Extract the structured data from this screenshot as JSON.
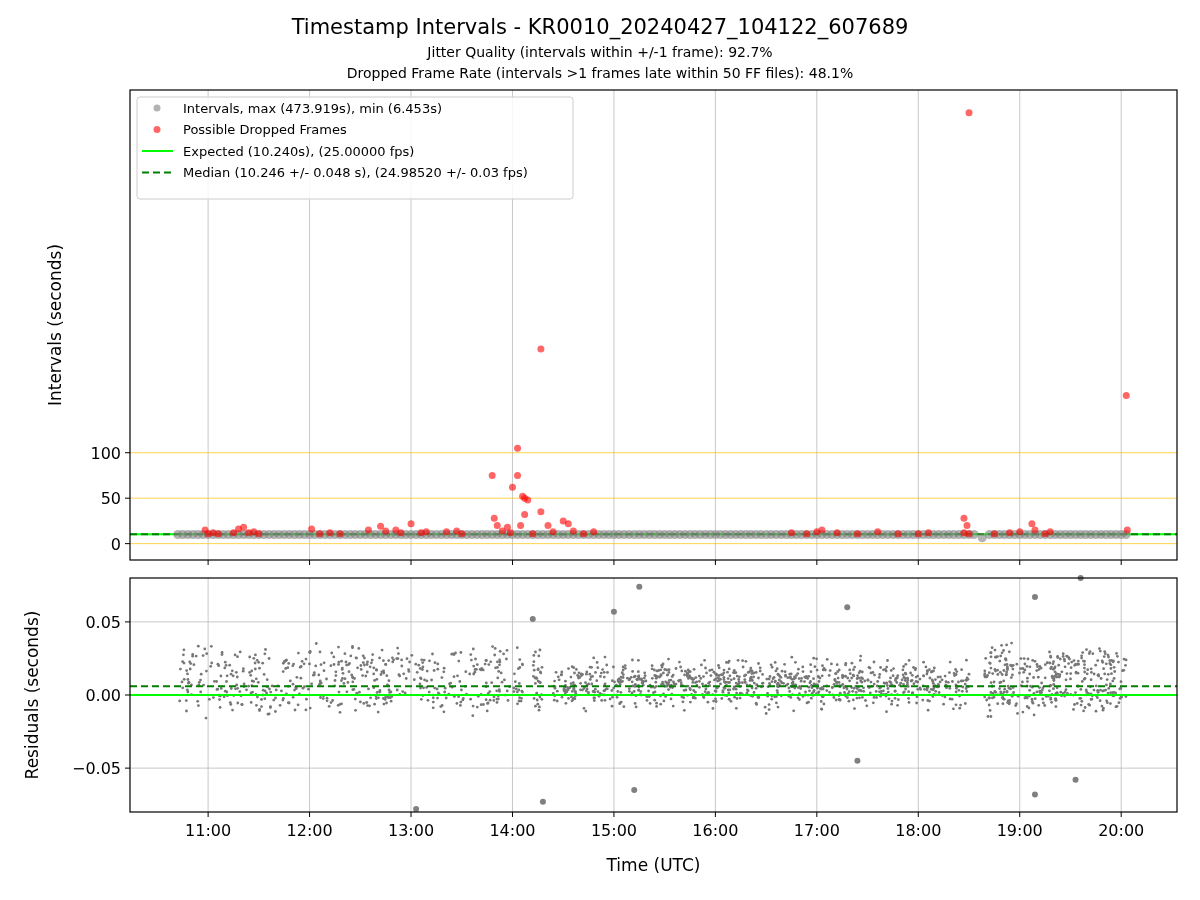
{
  "figure": {
    "title": "Timestamp Intervals - KR0010_20240427_104122_607689",
    "subtitles": [
      "Jitter Quality (intervals within +/-1 frame): 92.7%",
      "Dropped Frame Rate (intervals >1 frames late within 50 FF files): 48.1%"
    ]
  },
  "charts": [
    {
      "chart_data": {
        "type": "scatter",
        "ylabel": "Intervals (seconds)",
        "xlim": [
          10.23,
          20.55
        ],
        "ylim": [
          -18,
          499
        ],
        "grid": true,
        "yticks": [
          {
            "value": 0,
            "label": "0"
          },
          {
            "value": 50,
            "label": "50"
          },
          {
            "value": 100,
            "label": "100"
          }
        ],
        "series": [
          {
            "name": "Intervals, max (473.919s), min (6.453s)",
            "color": "#808080",
            "x": [
              10.7,
              10.75,
              10.8,
              10.85,
              10.9,
              10.95,
              11.0,
              11.05,
              11.1,
              11.15,
              11.2,
              11.25,
              11.3,
              11.35,
              11.4,
              11.45,
              11.5,
              11.55,
              11.6,
              11.65,
              11.7,
              11.75,
              11.8,
              11.85,
              11.9,
              11.95,
              12.0,
              12.05,
              12.1,
              12.15,
              12.2,
              12.25,
              12.3,
              12.35,
              12.4,
              12.45,
              12.5,
              12.55,
              12.6,
              12.65,
              12.7,
              12.75,
              12.8,
              12.85,
              12.9,
              12.95,
              13.0,
              13.05,
              13.1,
              13.15,
              13.2,
              13.25,
              13.3,
              13.35,
              13.4,
              13.45,
              13.5,
              13.55,
              13.6,
              13.65,
              13.7,
              13.75,
              13.8,
              13.85,
              13.9,
              13.95,
              14.0,
              14.05,
              14.1,
              14.15,
              14.2,
              14.25,
              14.3,
              14.35,
              14.4,
              14.45,
              14.5,
              14.55,
              14.6,
              14.65,
              14.7,
              14.75,
              14.8,
              14.85,
              14.9,
              14.95,
              15.0,
              15.05,
              15.1,
              15.15,
              15.2,
              15.25,
              15.3,
              15.35,
              15.4,
              15.45,
              15.5,
              15.55,
              15.6,
              15.65,
              15.7,
              15.75,
              15.8,
              15.85,
              15.9,
              15.95,
              16.0,
              16.05,
              16.1,
              16.15,
              16.2,
              16.25,
              16.3,
              16.35,
              16.4,
              16.45,
              16.5,
              16.55,
              16.6,
              16.65,
              16.7,
              16.75,
              16.8,
              16.85,
              16.9,
              16.95,
              17.0,
              17.05,
              17.1,
              17.15,
              17.2,
              17.25,
              17.3,
              17.35,
              17.4,
              17.45,
              17.5,
              17.55,
              17.6,
              17.65,
              17.7,
              17.75,
              17.8,
              17.85,
              17.9,
              17.95,
              18.0,
              18.05,
              18.1,
              18.15,
              18.2,
              18.25,
              18.3,
              18.35,
              18.4,
              18.45,
              18.5,
              18.55,
              18.63,
              18.7,
              18.75,
              18.8,
              18.85,
              18.9,
              18.95,
              19.0,
              19.05,
              19.1,
              19.15,
              19.2,
              19.25,
              19.3,
              19.35,
              19.4,
              19.45,
              19.5,
              19.55,
              19.6,
              19.65,
              19.7,
              19.75,
              19.8,
              19.85,
              19.9,
              19.95,
              20.0,
              20.05
            ],
            "values": [
              10,
              10,
              10,
              10,
              10,
              10,
              10,
              10,
              10,
              10,
              10,
              10,
              10,
              10,
              10,
              10,
              10,
              10,
              10,
              10,
              10,
              10,
              10,
              10,
              10,
              10,
              10,
              10,
              10,
              10,
              10,
              10,
              10,
              10,
              10,
              10,
              10,
              10,
              10,
              10,
              10,
              10,
              10,
              10,
              10,
              10,
              10,
              10,
              10,
              10,
              10,
              10,
              10,
              10,
              10,
              10,
              10,
              10,
              10,
              10,
              10,
              10,
              10,
              10,
              10,
              10,
              10,
              10,
              10,
              10,
              10,
              10,
              10,
              10,
              10,
              10,
              10,
              10,
              10,
              10,
              10,
              10,
              10,
              10,
              10,
              10,
              10,
              10,
              10,
              10,
              10,
              10,
              10,
              10,
              10,
              10,
              10,
              10,
              10,
              10,
              10,
              10,
              10,
              10,
              10,
              10,
              10,
              10,
              10,
              10,
              10,
              10,
              10,
              10,
              10,
              10,
              10,
              10,
              10,
              10,
              10,
              10,
              10,
              10,
              10,
              10,
              10,
              10,
              10,
              10,
              10,
              10,
              10,
              10,
              10,
              10,
              10,
              10,
              10,
              10,
              10,
              10,
              10,
              10,
              10,
              10,
              10,
              10,
              10,
              10,
              10,
              10,
              10,
              10,
              10,
              10,
              10,
              10,
              6.5,
              10,
              10,
              10,
              10,
              10,
              10,
              10,
              10,
              10,
              10,
              10,
              10,
              10,
              10,
              10,
              10,
              10,
              10,
              10,
              10,
              10,
              10,
              10,
              10,
              10,
              10,
              10,
              10
            ]
          },
          {
            "name": "Possible Dropped Frames",
            "color": "#ff0000",
            "x": [
              10.97,
              11.0,
              11.05,
              11.1,
              11.25,
              11.3,
              11.35,
              11.4,
              11.45,
              11.5,
              12.02,
              12.1,
              12.2,
              12.3,
              12.58,
              12.7,
              12.75,
              12.85,
              12.9,
              13.0,
              13.1,
              13.15,
              13.35,
              13.45,
              13.5,
              13.8,
              13.82,
              13.85,
              13.9,
              13.95,
              14.0,
              14.05,
              14.05,
              14.08,
              14.1,
              14.12,
              14.15,
              14.12,
              13.98,
              14.2,
              14.28,
              14.28,
              14.35,
              14.4,
              14.5,
              14.55,
              14.6,
              14.7,
              14.8,
              16.75,
              16.9,
              17.0,
              17.05,
              17.2,
              17.4,
              17.6,
              17.8,
              18.0,
              18.1,
              18.45,
              18.48,
              18.5,
              18.45,
              18.5,
              18.75,
              18.9,
              19.0,
              19.12,
              19.15,
              19.25,
              19.3,
              20.05,
              20.06
            ],
            "values": [
              15,
              11,
              12,
              11,
              12,
              16,
              18,
              12,
              13,
              11,
              16,
              11,
              12,
              11,
              15,
              19,
              14,
              15,
              12,
              22,
              12,
              13,
              13,
              14,
              11,
              75,
              28,
              20,
              14,
              18,
              62,
              105,
              75,
              20,
              52,
              50,
              48,
              32,
              12,
              11,
              35,
              214,
              20,
              13,
              25,
              22,
              14,
              11,
              13,
              12,
              11,
              13,
              15,
              12,
              11,
              13,
              11,
              11,
              12,
              28,
              20,
              474,
              12,
              11,
              11,
              12,
              13,
              22,
              15,
              11,
              13,
              163,
              15
            ]
          }
        ],
        "ref_lines": [
          {
            "axis": "y",
            "value": 10.24,
            "label": "Expected (10.240s), (25.00000 fps)",
            "color": "#00ff00"
          },
          {
            "axis": "y",
            "value": 10.246,
            "label": "Median (10.246 +/- 0.048 s), (24.98520 +/- 0.03 fps)",
            "color": "#008000"
          }
        ],
        "legend": "upper left"
      }
    },
    {
      "chart_data": {
        "type": "scatter",
        "xlabel": "Time (UTC)",
        "ylabel": "Residuals (seconds)",
        "xlim": [
          10.23,
          20.55
        ],
        "ylim": [
          -0.08,
          0.08
        ],
        "grid": true,
        "xticks": [
          {
            "value": 11,
            "label": "11:00"
          },
          {
            "value": 12,
            "label": "12:00"
          },
          {
            "value": 13,
            "label": "13:00"
          },
          {
            "value": 14,
            "label": "14:00"
          },
          {
            "value": 15,
            "label": "15:00"
          },
          {
            "value": 16,
            "label": "16:00"
          },
          {
            "value": 17,
            "label": "17:00"
          },
          {
            "value": 18,
            "label": "18:00"
          },
          {
            "value": 19,
            "label": "19:00"
          },
          {
            "value": 20,
            "label": "20:00"
          }
        ],
        "yticks": [
          {
            "value": 0.05,
            "label": "0.05"
          },
          {
            "value": 0,
            "label": "0.00"
          },
          {
            "value": -0.05,
            "label": "−0.05"
          }
        ],
        "series": [
          {
            "color": "#808080",
            "x": [
              13.05,
              14.3,
              15.2,
              15.25,
              17.4,
              19.15,
              19.55,
              19.15,
              19.6,
              14.2,
              15.0,
              17.3
            ],
            "values": [
              -0.078,
              -0.073,
              -0.065,
              0.074,
              -0.045,
              -0.068,
              -0.058,
              0.067,
              0.08,
              0.052,
              0.057,
              0.06
            ]
          }
        ],
        "ref_lines": [
          {
            "axis": "y",
            "value": 0,
            "color": "#00ff00"
          },
          {
            "axis": "y",
            "value": 0.006,
            "color": "#008000"
          }
        ]
      }
    }
  ]
}
